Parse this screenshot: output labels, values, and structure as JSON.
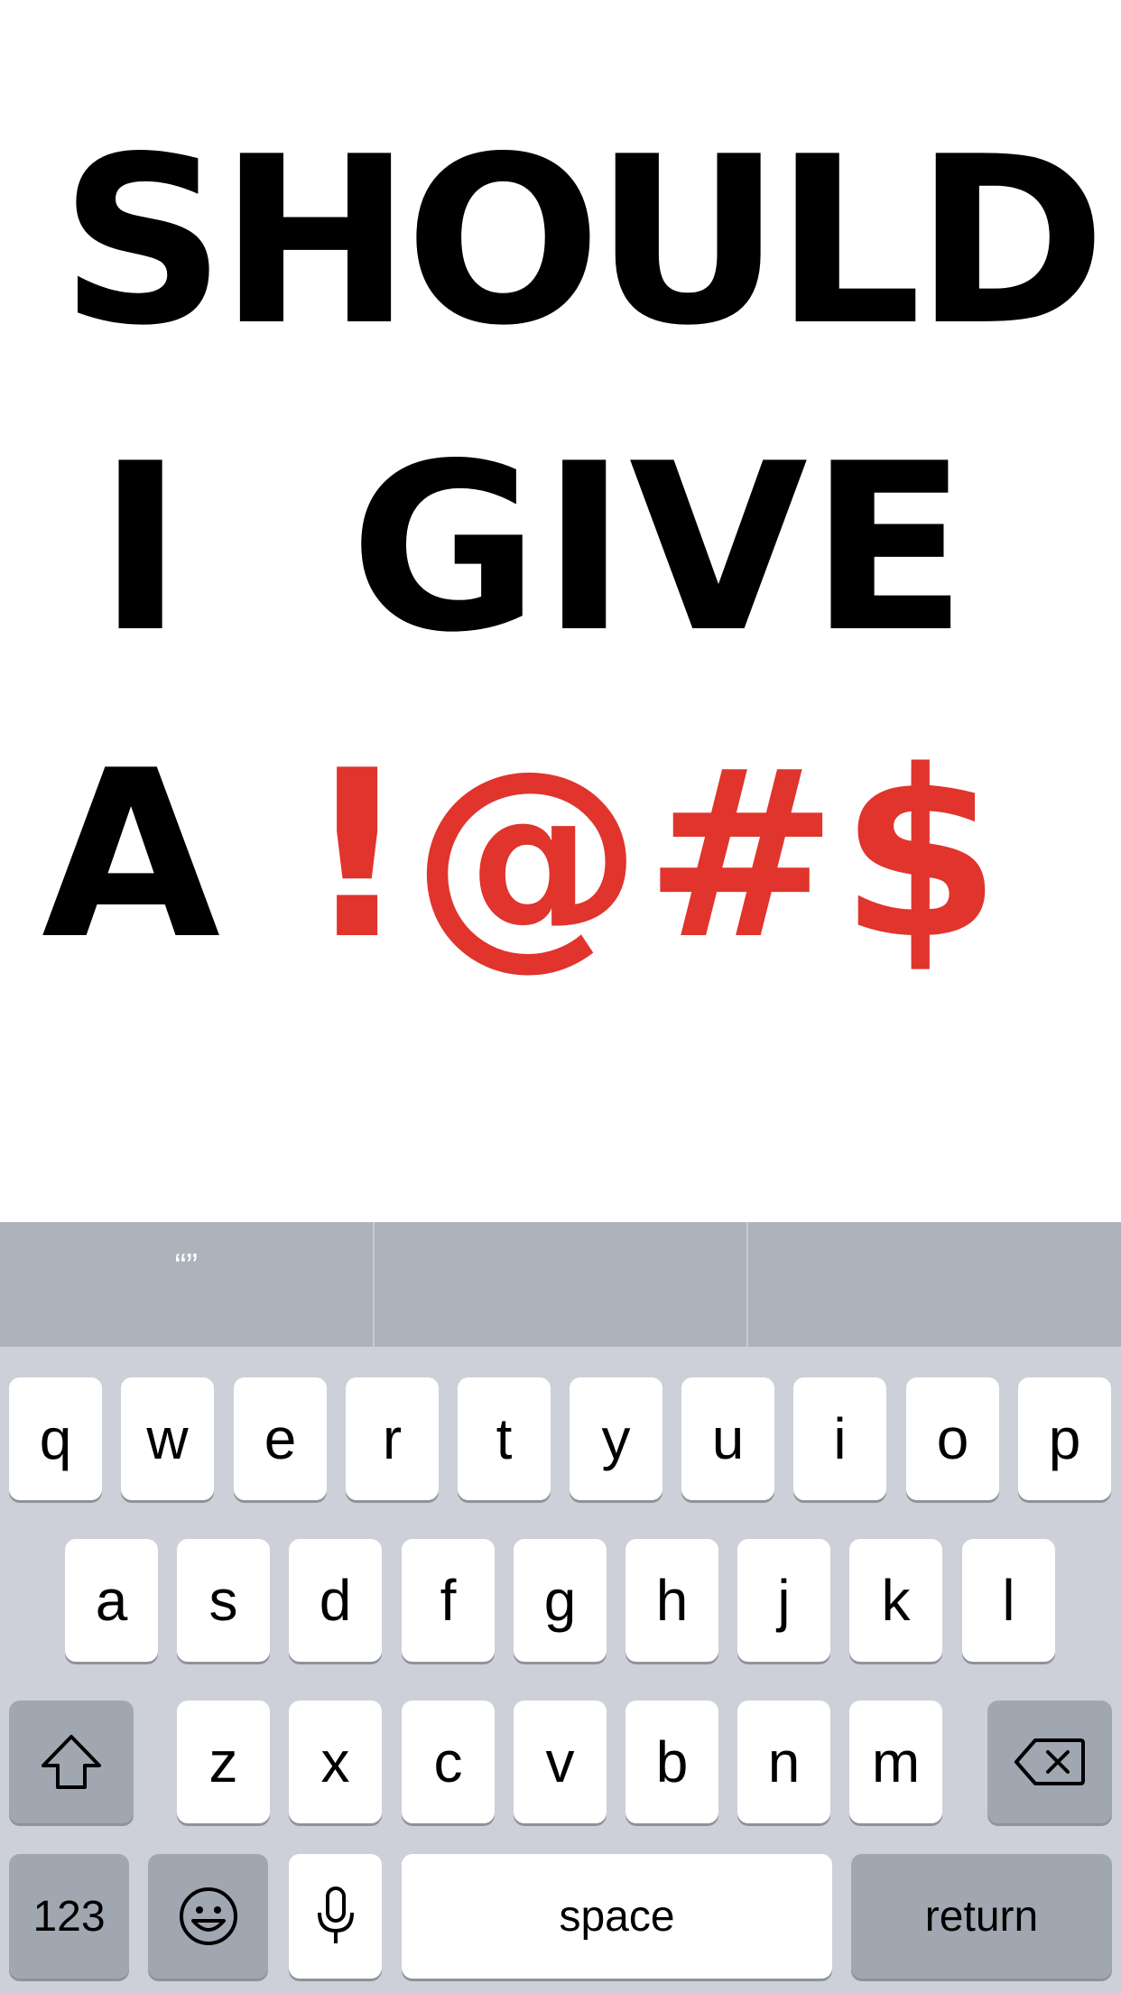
{
  "headline": {
    "line1": "SHOULD",
    "line2": "I  GIVE",
    "line3_prefix": "A ",
    "line3_accent": "!@#$"
  },
  "colors": {
    "accent": "#e0342c",
    "suggestion_bar": "#adb3bb",
    "keyboard_bg": "#cdd0d8",
    "special_key": "#a1a7b1"
  },
  "keyboard": {
    "suggestions": [
      "“”",
      "",
      ""
    ],
    "row1": [
      "q",
      "w",
      "e",
      "r",
      "t",
      "y",
      "u",
      "i",
      "o",
      "p"
    ],
    "row2": [
      "a",
      "s",
      "d",
      "f",
      "g",
      "h",
      "j",
      "k",
      "l"
    ],
    "row3": [
      "z",
      "x",
      "c",
      "v",
      "b",
      "n",
      "m"
    ],
    "shift_icon": "shift-icon",
    "delete_icon": "delete-icon",
    "numbers_label": "123",
    "emoji_icon": "emoji-icon",
    "mic_icon": "microphone-icon",
    "space_label": "space",
    "return_label": "return"
  }
}
